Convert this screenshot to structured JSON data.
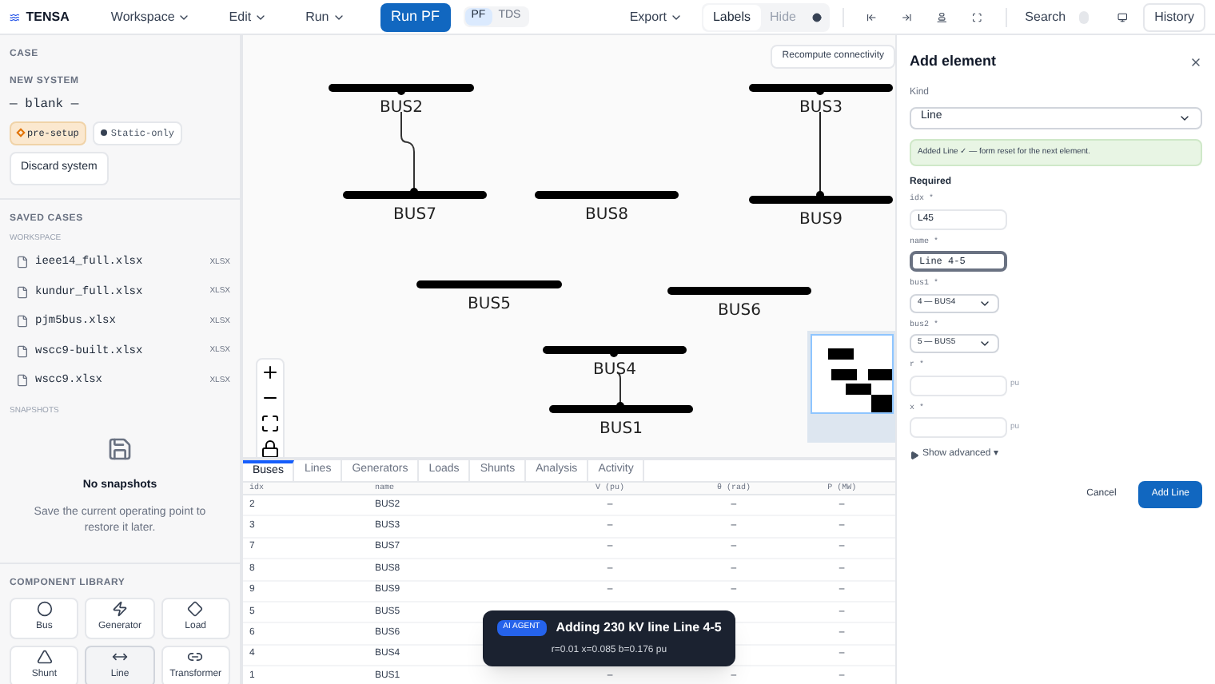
{
  "app": {
    "name": "TENSA"
  },
  "menu": [
    {
      "label": "Workspace"
    },
    {
      "label": "Edit"
    },
    {
      "label": "Run"
    }
  ],
  "run_button": "Run PF",
  "mode_toggle": [
    {
      "label": "PF",
      "selected": true
    },
    {
      "label": "TDS",
      "selected": false
    }
  ],
  "export_menu": "Export",
  "label_toggle": [
    {
      "label": "Labels",
      "selected": true
    },
    {
      "label": "Hide",
      "selected": false
    }
  ],
  "search": "Search",
  "history": "History",
  "sidebar": {
    "case_heading": "CASE",
    "system_heading": "NEW SYSTEM",
    "system_name": "— blank —",
    "tags": [
      {
        "label": "pre-setup",
        "kind": "warning"
      },
      {
        "label": "Static-only",
        "kind": "neutral"
      }
    ],
    "discard": "Discard system",
    "saved_heading": "SAVED CASES",
    "workspace_heading": "WORKSPACE",
    "files": [
      {
        "name": "ieee14_full.xlsx",
        "type": "XLSX"
      },
      {
        "name": "kundur_full.xlsx",
        "type": "XLSX"
      },
      {
        "name": "pjm5bus.xlsx",
        "type": "XLSX"
      },
      {
        "name": "wscc9-built.xlsx",
        "type": "XLSX"
      },
      {
        "name": "wscc9.xlsx",
        "type": "XLSX"
      }
    ],
    "snapshots_heading": "SNAPSHOTS",
    "empty_title": "No snapshots",
    "empty_text": "Save the current operating point to restore it later.",
    "library_heading": "COMPONENT LIBRARY",
    "components": [
      {
        "label": "Bus",
        "kind": "bus",
        "selected": false
      },
      {
        "label": "Generator",
        "kind": "generator",
        "selected": false
      },
      {
        "label": "Load",
        "kind": "load",
        "selected": false
      },
      {
        "label": "Shunt",
        "kind": "shunt",
        "selected": false
      },
      {
        "label": "Line",
        "kind": "line",
        "selected": true
      },
      {
        "label": "Transformer",
        "kind": "transformer",
        "selected": false
      }
    ]
  },
  "canvas": {
    "recompute": "Recompute connectivity",
    "buses": [
      {
        "name": "BUS2"
      },
      {
        "name": "BUS7"
      },
      {
        "name": "BUS8"
      },
      {
        "name": "BUS3"
      },
      {
        "name": "BUS9"
      },
      {
        "name": "BUS5"
      },
      {
        "name": "BUS6"
      },
      {
        "name": "BUS4"
      },
      {
        "name": "BUS1"
      }
    ]
  },
  "table": {
    "tabs": [
      {
        "label": "Buses",
        "selected": true
      },
      {
        "label": "Lines",
        "selected": false
      },
      {
        "label": "Generators",
        "selected": false
      },
      {
        "label": "Loads",
        "selected": false
      },
      {
        "label": "Shunts",
        "selected": false
      },
      {
        "label": "Analysis",
        "selected": false
      },
      {
        "label": "Activity",
        "selected": false
      }
    ],
    "columns": [
      "idx",
      "name",
      "V (pu)",
      "θ (rad)",
      "P (MW)"
    ],
    "rows": [
      [
        "2",
        "BUS2",
        "–",
        "–",
        "–"
      ],
      [
        "3",
        "BUS3",
        "–",
        "–",
        "–"
      ],
      [
        "7",
        "BUS7",
        "–",
        "–",
        "–"
      ],
      [
        "8",
        "BUS8",
        "–",
        "–",
        "–"
      ],
      [
        "9",
        "BUS9",
        "–",
        "–",
        "–"
      ],
      [
        "5",
        "BUS5",
        null,
        null,
        "–"
      ],
      [
        "6",
        "BUS6",
        null,
        null,
        "–"
      ],
      [
        "4",
        "BUS4",
        null,
        null,
        "–"
      ],
      [
        "1",
        "BUS1",
        "–",
        "–",
        "–"
      ]
    ]
  },
  "toast": {
    "badge": "AI AGENT",
    "title": "Adding 230 kV line Line 4-5",
    "detail": "r=0.01 x=0.085 b=0.176 pu"
  },
  "panel": {
    "title": "Add element",
    "kind_label": "Kind",
    "kind_value": "Line",
    "notice": "Added Line ✓ — form reset for the next element.",
    "section": "Required",
    "fields": [
      {
        "label": "idx *",
        "value": "L45",
        "kind": "text",
        "focused": false
      },
      {
        "label": "name *",
        "value": "Line 4-5",
        "kind": "text",
        "focused": true
      },
      {
        "label": "bus1 *",
        "value": "4 — BUS4",
        "kind": "select",
        "focused": false
      },
      {
        "label": "bus2 *",
        "value": "5 — BUS5",
        "kind": "select",
        "focused": false
      },
      {
        "label": "r *",
        "kind": "number",
        "unit": "pu",
        "focused": false
      },
      {
        "label": "x *",
        "kind": "number",
        "unit": "pu",
        "focused": false
      }
    ],
    "advanced": "Show advanced ▾",
    "cancel": "Cancel",
    "submit": "Add Line"
  }
}
